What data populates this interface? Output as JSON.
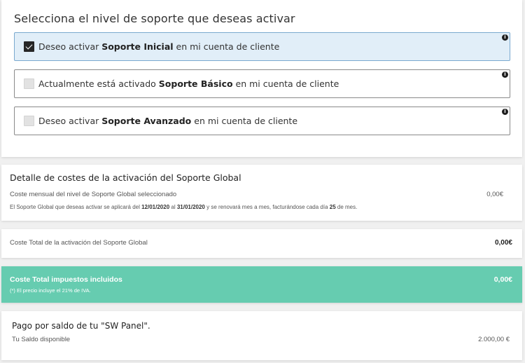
{
  "support_selection": {
    "title": "Selecciona el nivel de soporte que deseas activar",
    "options": [
      {
        "prefix": "Deseo activar ",
        "bold": "Soporte Inicial",
        "suffix": " en mi cuenta de cliente",
        "checked": true,
        "info_icon": "info-icon"
      },
      {
        "prefix": "Actualmente está activado ",
        "bold": "Soporte Básico",
        "suffix": " en mi cuenta de cliente",
        "checked": false,
        "info_icon": "info-icon"
      },
      {
        "prefix": "Deseo activar ",
        "bold": "Soporte Avanzado",
        "suffix": " en mi cuenta de cliente",
        "checked": false,
        "info_icon": "info-icon"
      }
    ]
  },
  "cost_detail": {
    "title": "Detalle de costes de la activación del Soporte Global",
    "monthly_label": "Coste mensual del nivel de Soporte Global seleccionado",
    "monthly_amount": "0,00€",
    "note": {
      "part1": "El Soporte Global que deseas activar se aplicará del ",
      "date_from": "12/01/2020",
      "part2": " al ",
      "date_to": "31/01/2020",
      "part3": " y se renovará mes a mes, facturándose cada día ",
      "day": "25",
      "part4": " de mes."
    }
  },
  "total": {
    "label": "Coste Total de la activación del Soporte Global",
    "amount": "0,00€"
  },
  "taxes": {
    "label": "Coste Total impuestos incluidos",
    "note": "(*) El precio incluye el 21% de IVA.",
    "amount": "0,00€",
    "background_color": "#66ccb0"
  },
  "payment": {
    "title": "Pago por saldo de tu \"SW Panel\".",
    "balance_label": "Tu Saldo disponible",
    "balance_amount": "2.000,00 €"
  }
}
